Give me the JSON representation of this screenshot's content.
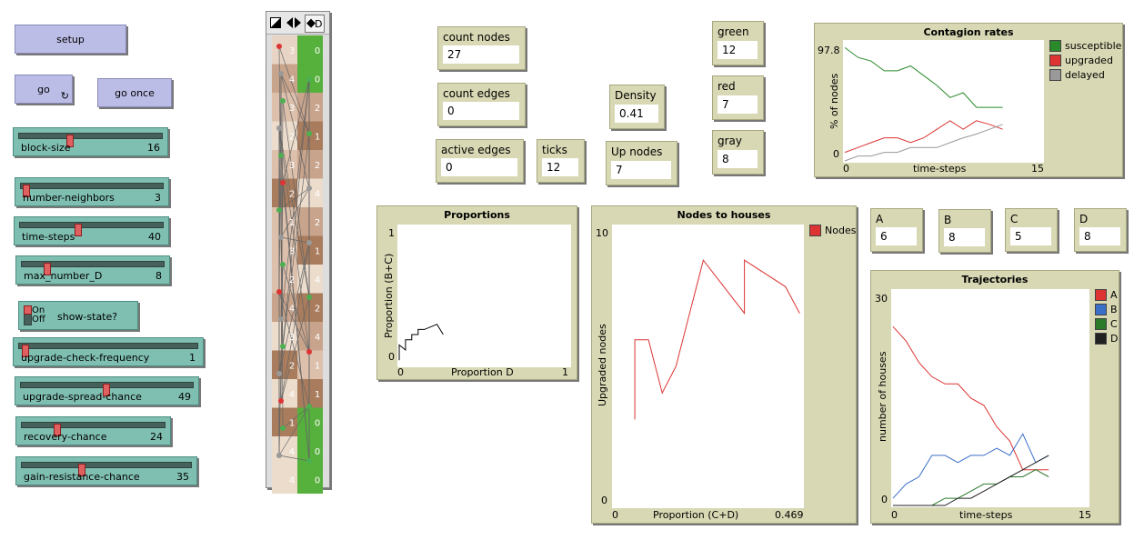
{
  "buttons": {
    "setup": "setup",
    "go": "go",
    "go_once": "go once",
    "forever_glyph": "↻"
  },
  "sliders": [
    {
      "label": "block-size",
      "value": "16",
      "fraction": 0.35
    },
    {
      "label": "number-neighbors",
      "value": "3",
      "fraction": 0.0
    },
    {
      "label": "time-steps",
      "value": "40",
      "fraction": 0.4
    },
    {
      "label": "max_number_D",
      "value": "8",
      "fraction": 0.17
    },
    {
      "label": "upgrade-check-frequency",
      "value": "1",
      "fraction": 0.0
    },
    {
      "label": "upgrade-spread-chance",
      "value": "49",
      "fraction": 0.49
    },
    {
      "label": "recovery-chance",
      "value": "24",
      "fraction": 0.24
    },
    {
      "label": "gain-resistance-chance",
      "value": "35",
      "fraction": 0.35
    }
  ],
  "switch": {
    "on": "On",
    "off": "Off",
    "label": "show-state?",
    "state": "off"
  },
  "view_toolbar": {
    "speed_glyph": "◆",
    "d_label": "D"
  },
  "monitors": {
    "count_nodes": {
      "label": "count nodes",
      "value": "27"
    },
    "count_edges": {
      "label": "count edges",
      "value": "0"
    },
    "active_edges": {
      "label": "active edges",
      "value": "0"
    },
    "ticks": {
      "label": "ticks",
      "value": "12"
    },
    "density": {
      "label": "Density",
      "value": "0.41"
    },
    "up_nodes": {
      "label": "Up nodes",
      "value": "7"
    },
    "green": {
      "label": "green",
      "value": "12"
    },
    "red": {
      "label": "red",
      "value": "7"
    },
    "gray": {
      "label": "gray",
      "value": "8"
    },
    "A": {
      "label": "A",
      "value": "6"
    },
    "B": {
      "label": "B",
      "value": "8"
    },
    "C": {
      "label": "C",
      "value": "5"
    },
    "D": {
      "label": "D",
      "value": "8"
    }
  },
  "view_cells": [
    {
      "code": "3",
      "color": "#e8d4c4"
    },
    {
      "code": "0",
      "color": "#56b03c"
    },
    {
      "code": "4",
      "color": "#c8a48c"
    },
    {
      "code": "0",
      "color": "#56b03c"
    },
    {
      "code": "3",
      "color": "#dcc0ac"
    },
    {
      "code": "2",
      "color": "#c8a48c"
    },
    {
      "code": "2",
      "color": "#ecdccc"
    },
    {
      "code": "1",
      "color": "#a87c5c"
    },
    {
      "code": "3",
      "color": "#dcc0ac"
    },
    {
      "code": "2",
      "color": "#c8a48c"
    },
    {
      "code": "2",
      "color": "#a87c5c"
    },
    {
      "code": "4",
      "color": "#ecdccc"
    },
    {
      "code": "1",
      "color": "#dcc0ac"
    },
    {
      "code": "2",
      "color": "#c8a48c"
    },
    {
      "code": "3",
      "color": "#dcc0ac"
    },
    {
      "code": "1",
      "color": "#a87c5c"
    },
    {
      "code": "2",
      "color": "#dcc0ac"
    },
    {
      "code": "4",
      "color": "#ecdccc"
    },
    {
      "code": "4",
      "color": "#c8a48c"
    },
    {
      "code": "2",
      "color": "#a87c5c"
    },
    {
      "code": "3",
      "color": "#ecdccc"
    },
    {
      "code": "4",
      "color": "#c8a48c"
    },
    {
      "code": "2",
      "color": "#a87c5c"
    },
    {
      "code": "1",
      "color": "#dcc0ac"
    },
    {
      "code": "4",
      "color": "#ecdccc"
    },
    {
      "code": "1",
      "color": "#a87c5c"
    },
    {
      "code": "1",
      "color": "#a87c5c"
    },
    {
      "code": "0",
      "color": "#56b03c"
    },
    {
      "code": "4",
      "color": "#ecdccc"
    },
    {
      "code": "0",
      "color": "#56b03c"
    },
    {
      "code": "4",
      "color": "#ecdccc"
    },
    {
      "code": "0",
      "color": "#56b03c"
    }
  ],
  "plots": {
    "contagion": {
      "title": "Contagion rates",
      "ylabel": "% of nodes",
      "xlabel": "time-steps",
      "ymax_label": "97.8",
      "ymin_label": "0",
      "xmin_label": "0",
      "xmax_label": "15",
      "legend": [
        {
          "name": "susceptible",
          "color": "#2a8a2a"
        },
        {
          "name": "upgraded",
          "color": "#dd3333"
        },
        {
          "name": "delayed",
          "color": "#999999"
        }
      ]
    },
    "proportions": {
      "title": "Proportions",
      "ylabel": "Proportion (B+C)",
      "xlabel": "Proportion D",
      "ymax_label": "1",
      "ymin_label": "0",
      "xmin_label": "0",
      "xmax_label": "1"
    },
    "nodes_houses": {
      "title": "Nodes to houses",
      "ylabel": "Upgraded nodes",
      "xlabel": "Proportion (C+D)",
      "ymax_label": "10",
      "ymin_label": "0",
      "xmin_label": "0",
      "xmax_label": "0.469",
      "legend": [
        {
          "name": "Nodes",
          "color": "#dd3333"
        }
      ]
    },
    "trajectories": {
      "title": "Trajectories",
      "ylabel": "number of houses",
      "xlabel": "time-steps",
      "ymax_label": "30",
      "ymin_label": "0",
      "xmin_label": "0",
      "xmax_label": "15",
      "legend": [
        {
          "name": "A",
          "color": "#dd3333"
        },
        {
          "name": "B",
          "color": "#3a6fc8"
        },
        {
          "name": "C",
          "color": "#2a7a2a"
        },
        {
          "name": "D",
          "color": "#222222"
        }
      ]
    }
  },
  "chart_data": [
    {
      "type": "line",
      "title": "Contagion rates",
      "xlabel": "time-steps",
      "ylabel": "% of nodes",
      "xlim": [
        0,
        15
      ],
      "ylim": [
        0,
        97.8
      ],
      "x": [
        0,
        1,
        2,
        3,
        4,
        5,
        6,
        7,
        8,
        9,
        10,
        11,
        12
      ],
      "series": [
        {
          "name": "susceptible",
          "values": [
            93,
            85,
            82,
            74,
            74,
            78,
            70,
            62,
            52,
            56,
            44,
            44,
            44
          ]
        },
        {
          "name": "upgraded",
          "values": [
            7,
            11,
            15,
            19,
            19,
            15,
            19,
            26,
            33,
            26,
            33,
            30,
            26
          ]
        },
        {
          "name": "delayed",
          "values": [
            0,
            4,
            4,
            7,
            7,
            11,
            11,
            11,
            15,
            19,
            22,
            26,
            30
          ]
        }
      ]
    },
    {
      "type": "line",
      "title": "Proportions",
      "xlabel": "Proportion D",
      "ylabel": "Proportion (B+C)",
      "xlim": [
        0,
        1
      ],
      "ylim": [
        0,
        1
      ],
      "series": [
        {
          "x": [
            0,
            0,
            0.037,
            0.037,
            0.074,
            0.074,
            0.111,
            0.111,
            0.148,
            0.222,
            0.259
          ],
          "y": [
            0.037,
            0.148,
            0.111,
            0.185,
            0.185,
            0.222,
            0.222,
            0.259,
            0.259,
            0.296,
            0.222
          ]
        }
      ]
    },
    {
      "type": "line",
      "title": "Nodes to houses",
      "xlabel": "Proportion (C+D)",
      "ylabel": "Upgraded nodes",
      "xlim": [
        0,
        0.469
      ],
      "ylim": [
        0,
        10
      ],
      "series": [
        {
          "name": "Nodes",
          "x": [
            0.037,
            0.037,
            0.074,
            0.111,
            0.148,
            0.222,
            0.333,
            0.333,
            0.444,
            0.482
          ],
          "y": [
            3,
            6,
            6,
            4,
            5,
            9,
            7,
            9,
            8,
            7
          ]
        }
      ]
    },
    {
      "type": "line",
      "title": "Trajectories",
      "xlabel": "time-steps",
      "ylabel": "number of houses",
      "xlim": [
        0,
        15
      ],
      "ylim": [
        0,
        30
      ],
      "x": [
        0,
        1,
        2,
        3,
        4,
        5,
        6,
        7,
        8,
        9,
        10,
        11,
        12
      ],
      "series": [
        {
          "name": "A",
          "values": [
            25,
            23,
            20,
            18,
            17,
            17,
            15,
            14,
            11,
            9,
            5,
            5,
            5
          ]
        },
        {
          "name": "B",
          "values": [
            1,
            3,
            4,
            7,
            7,
            6,
            7,
            7,
            8,
            7,
            10,
            6,
            7
          ]
        },
        {
          "name": "C",
          "values": [
            0,
            0,
            0,
            0,
            1,
            1,
            2,
            3,
            3,
            4,
            4,
            5,
            4
          ]
        },
        {
          "name": "D",
          "values": [
            0,
            0,
            0,
            0,
            0,
            1,
            1,
            2,
            3,
            4,
            5,
            6,
            7
          ]
        }
      ]
    }
  ]
}
